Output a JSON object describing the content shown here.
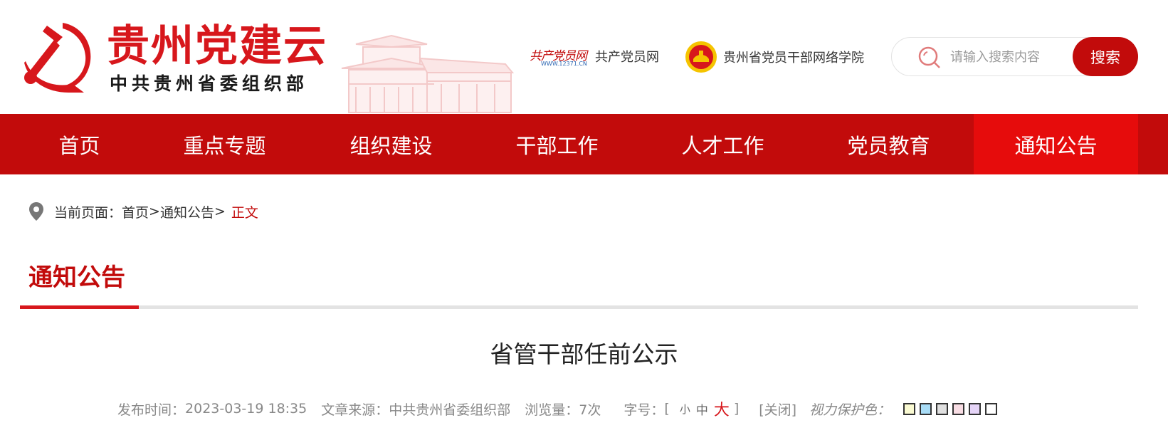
{
  "brand": {
    "title": "贵州党建云",
    "subtitle": "中共贵州省委组织部"
  },
  "header_links": [
    {
      "logo_text": "共产党员网",
      "logo_url_text": "WWW.12371.CN",
      "label": "共产党员网"
    },
    {
      "label": "贵州省党员干部网络学院"
    }
  ],
  "search": {
    "placeholder": "请输入搜索内容",
    "button_label": "搜索"
  },
  "nav": {
    "items": [
      {
        "label": "首页",
        "active": false
      },
      {
        "label": "重点专题",
        "active": false
      },
      {
        "label": "组织建设",
        "active": false
      },
      {
        "label": "干部工作",
        "active": false
      },
      {
        "label": "人才工作",
        "active": false
      },
      {
        "label": "党员教育",
        "active": false
      },
      {
        "label": "通知公告",
        "active": true
      }
    ]
  },
  "breadcrumb": {
    "prefix": "当前页面：",
    "home": "首页",
    "sep1": " >",
    "section": "通知公告",
    "sep2": ">",
    "current": "正文"
  },
  "section": {
    "title": "通知公告"
  },
  "article": {
    "title": "省管干部任前公示",
    "publish_label": "发布时间：",
    "publish_time": "2023-03-19 18:35",
    "source_label": "文章来源：",
    "source": "中共贵州省委组织部",
    "views_label": "浏览量：",
    "views": "7次",
    "font_label": "字号：",
    "font_open": "[",
    "font_small": "小",
    "font_medium": "中",
    "font_large": "大",
    "font_close": "]",
    "close_label": "[关闭]",
    "eye_label": "视力保护色："
  },
  "colors": {
    "primary_red": "#c20b0b",
    "active_red": "#e60c0c",
    "accent_red": "#d7171c",
    "swatches": [
      "#fafad2",
      "#a8dcf6",
      "#e0e0e0",
      "#f8dde4",
      "#e5d4f7",
      "#ffffff"
    ]
  }
}
